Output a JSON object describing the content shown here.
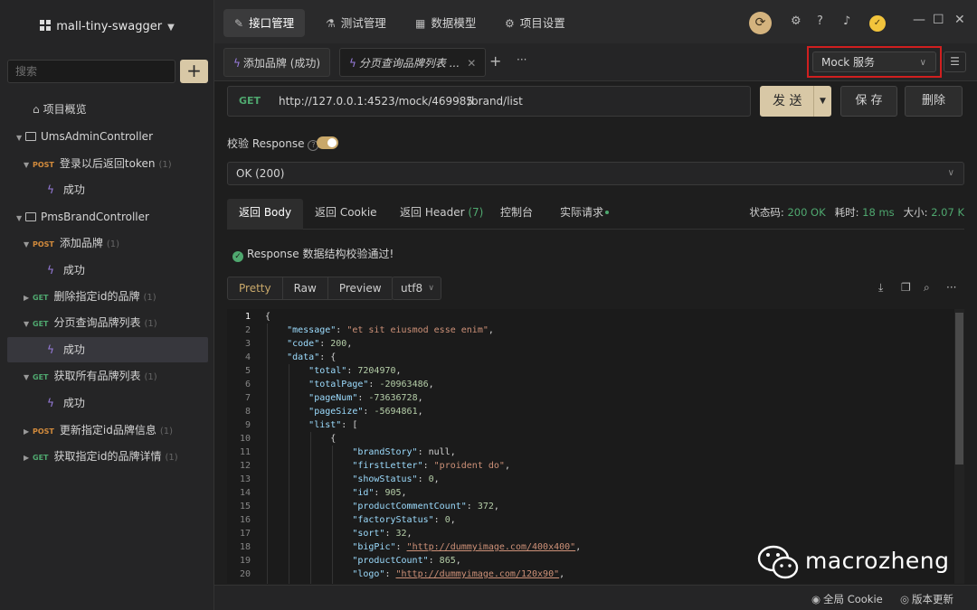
{
  "sidebar": {
    "project_title": "mall-tiny-swagger",
    "search_placeholder": "搜索",
    "add_label": "+",
    "items": [
      {
        "label": "项目概览"
      },
      {
        "label": "UmsAdminController"
      },
      {
        "method": "POST",
        "label": "登录以后返回token",
        "count": "(1)"
      },
      {
        "label": "成功"
      },
      {
        "label": "PmsBrandController"
      },
      {
        "method": "POST",
        "label": "添加品牌",
        "count": "(1)"
      },
      {
        "label": "成功"
      },
      {
        "method": "GET",
        "label": "删除指定id的品牌",
        "count": "(1)"
      },
      {
        "method": "GET",
        "label": "分页查询品牌列表",
        "count": "(1)"
      },
      {
        "label": "成功"
      },
      {
        "method": "GET",
        "label": "获取所有品牌列表",
        "count": "(1)"
      },
      {
        "label": "成功"
      },
      {
        "method": "POST",
        "label": "更新指定id品牌信息",
        "count": "(1)"
      },
      {
        "method": "GET",
        "label": "获取指定id的品牌详情",
        "count": "(1)"
      }
    ]
  },
  "topnav": {
    "tabs": [
      "接口管理",
      "测试管理",
      "数据模型",
      "项目设置"
    ]
  },
  "tabs": {
    "open": [
      "添加品牌 (成功)",
      "分页查询品牌列表 ..."
    ],
    "plus": "+",
    "more": "···",
    "env_select": "Mock 服务"
  },
  "request": {
    "method": "GET",
    "base_url": "http://127.0.0.1:4523/mock/469985",
    "path": "/brand/list",
    "send": "发 送",
    "save": "保 存",
    "delete": "删除"
  },
  "validate": {
    "label": "校验 Response",
    "response_option": "OK (200)"
  },
  "response": {
    "tabs": [
      "返回 Body",
      "返回 Cookie",
      "返回 Header",
      "控制台",
      "实际请求"
    ],
    "header_count": "(7)",
    "status_label": "状态码:",
    "status_value": "200 OK",
    "time_label": "耗时:",
    "time_value": "18 ms",
    "size_label": "大小:",
    "size_value": "2.07 K",
    "pass_message": "Response 数据结构校验通过!",
    "formats": [
      "Pretty",
      "Raw",
      "Preview"
    ],
    "encoding": "utf8"
  },
  "code_lines": [
    {
      "indent": 0,
      "key": null,
      "open": "{"
    },
    {
      "indent": 1,
      "key": "message",
      "val": "\"et sit eiusmod esse enim\"",
      "type": "s",
      "comma": true
    },
    {
      "indent": 1,
      "key": "code",
      "val": "200",
      "type": "n",
      "comma": true
    },
    {
      "indent": 1,
      "key": "data",
      "open": "{"
    },
    {
      "indent": 2,
      "key": "total",
      "val": "7204970",
      "type": "n",
      "comma": true
    },
    {
      "indent": 2,
      "key": "totalPage",
      "val": "-20963486",
      "type": "n",
      "comma": true
    },
    {
      "indent": 2,
      "key": "pageNum",
      "val": "-73636728",
      "type": "n",
      "comma": true
    },
    {
      "indent": 2,
      "key": "pageSize",
      "val": "-5694861",
      "type": "n",
      "comma": true
    },
    {
      "indent": 2,
      "key": "list",
      "open": "["
    },
    {
      "indent": 3,
      "key": null,
      "open": "{"
    },
    {
      "indent": 4,
      "key": "brandStory",
      "val": "null",
      "type": "p",
      "comma": true
    },
    {
      "indent": 4,
      "key": "firstLetter",
      "val": "\"proident do\"",
      "type": "s",
      "comma": true
    },
    {
      "indent": 4,
      "key": "showStatus",
      "val": "0",
      "type": "n",
      "comma": true
    },
    {
      "indent": 4,
      "key": "id",
      "val": "905",
      "type": "n",
      "comma": true
    },
    {
      "indent": 4,
      "key": "productCommentCount",
      "val": "372",
      "type": "n",
      "comma": true
    },
    {
      "indent": 4,
      "key": "factoryStatus",
      "val": "0",
      "type": "n",
      "comma": true
    },
    {
      "indent": 4,
      "key": "sort",
      "val": "32",
      "type": "n",
      "comma": true
    },
    {
      "indent": 4,
      "key": "bigPic",
      "val": "\"http://dummyimage.com/400x400\"",
      "type": "u",
      "comma": true
    },
    {
      "indent": 4,
      "key": "productCount",
      "val": "865",
      "type": "n",
      "comma": true
    },
    {
      "indent": 4,
      "key": "logo",
      "val": "\"http://dummyimage.com/120x90\"",
      "type": "u",
      "comma": true
    }
  ],
  "statusbar": {
    "cookie": "全局 Cookie",
    "update": "版本更新"
  },
  "watermark": "macrozheng",
  "colors": {
    "accent": "#d8c8a6",
    "get": "#4fa86f",
    "post": "#d38b3c",
    "highlight_border": "#d01f1f"
  }
}
